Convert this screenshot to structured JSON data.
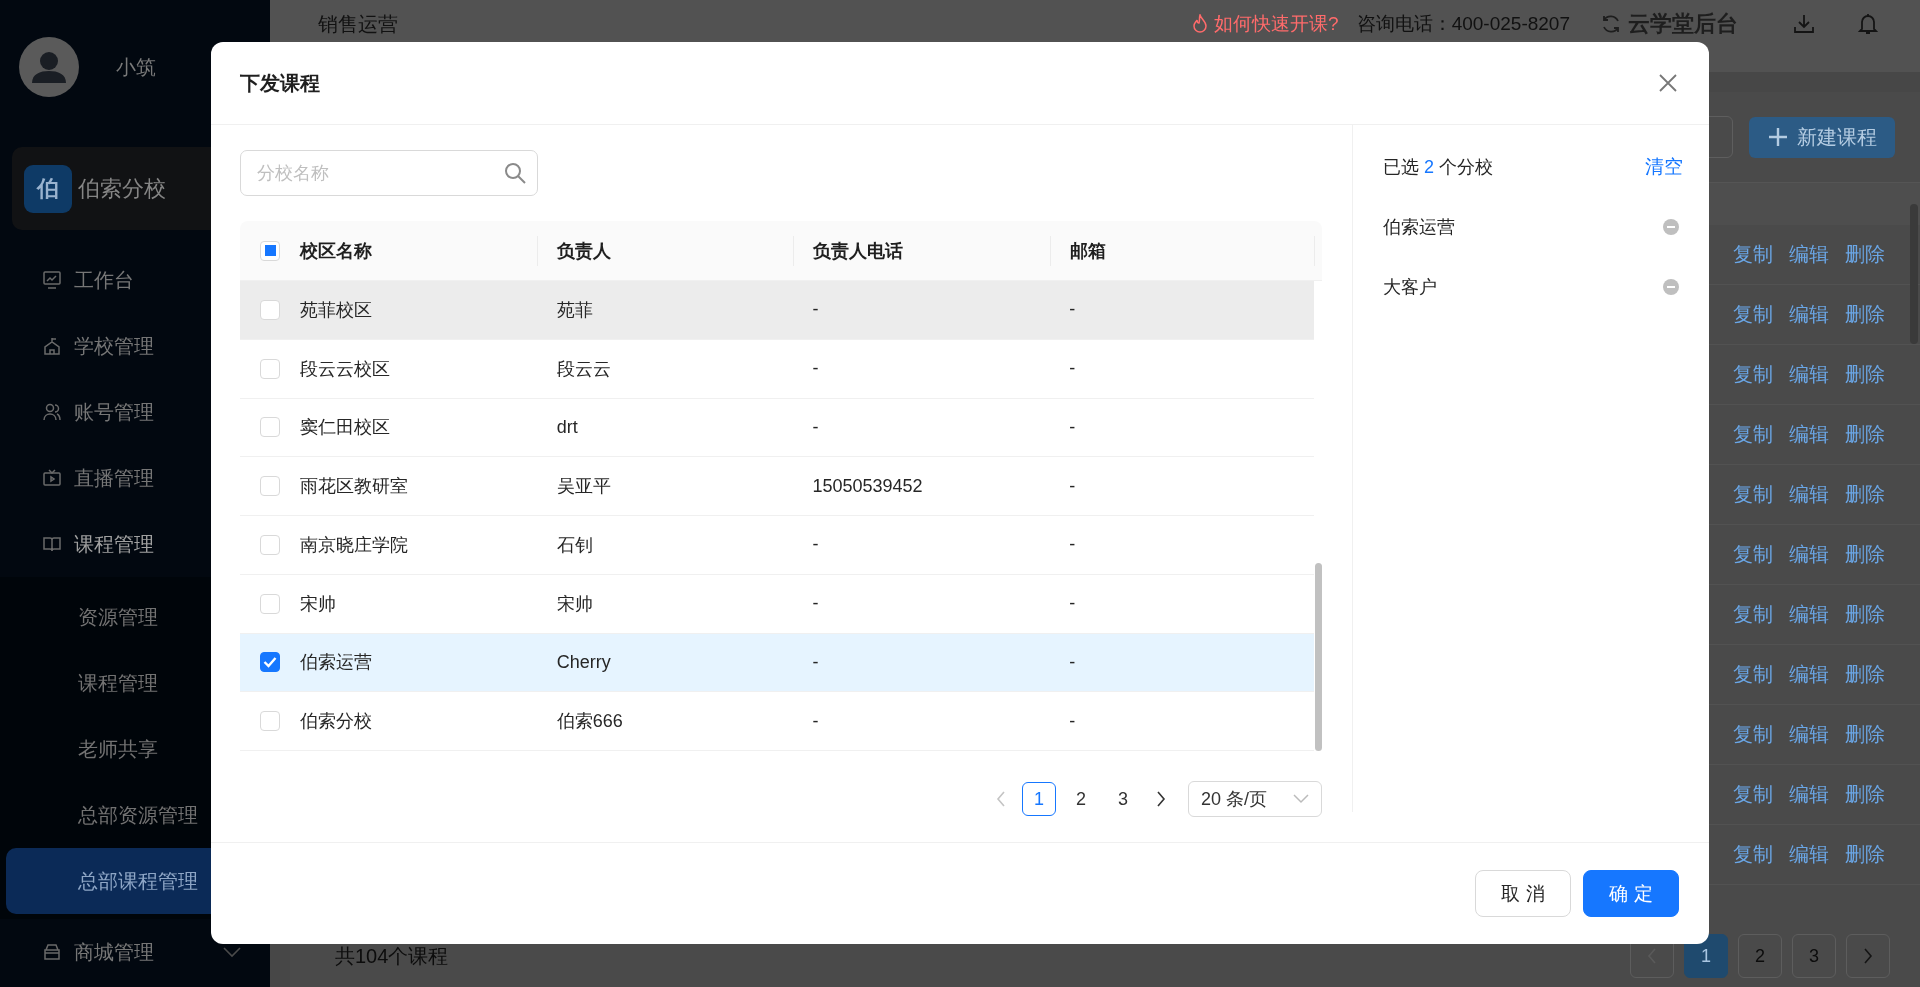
{
  "sidebar": {
    "user": {
      "name": "小筑"
    },
    "school": {
      "badge": "伯",
      "name": "伯索分校"
    },
    "menu": [
      {
        "label": "工作台"
      },
      {
        "label": "学校管理"
      },
      {
        "label": "账号管理"
      },
      {
        "label": "直播管理"
      },
      {
        "label": "课程管理",
        "expanded": true,
        "children": [
          {
            "label": "资源管理",
            "selected": false
          },
          {
            "label": "课程管理",
            "selected": false
          },
          {
            "label": "老师共享",
            "selected": false
          },
          {
            "label": "总部资源管理",
            "selected": false
          },
          {
            "label": "总部课程管理",
            "selected": true
          }
        ]
      },
      {
        "label": "商城管理",
        "expanded": false
      }
    ]
  },
  "header": {
    "title": "销售运营",
    "help_link": "如何快速开课?",
    "hotline": "咨询电话：400-025-8207",
    "brand": "云学堂后台"
  },
  "toolbar": {
    "new_button": "新建课程"
  },
  "course_table": {
    "rows": [
      {
        "actions": [
          "复制",
          "编辑",
          "删除"
        ]
      },
      {
        "actions": [
          "复制",
          "编辑",
          "删除"
        ]
      },
      {
        "actions": [
          "复制",
          "编辑",
          "删除"
        ]
      },
      {
        "actions": [
          "复制",
          "编辑",
          "删除"
        ]
      },
      {
        "actions": [
          "复制",
          "编辑",
          "删除"
        ]
      },
      {
        "actions": [
          "复制",
          "编辑",
          "删除"
        ]
      },
      {
        "actions": [
          "复制",
          "编辑",
          "删除"
        ]
      },
      {
        "actions": [
          "复制",
          "编辑",
          "删除"
        ]
      },
      {
        "actions": [
          "复制",
          "编辑",
          "删除"
        ]
      },
      {
        "actions": [
          "复制",
          "编辑",
          "删除"
        ]
      },
      {
        "actions": [
          "复制",
          "编辑",
          "删除"
        ]
      }
    ],
    "total": "共104个课程",
    "pages": [
      {
        "label": "1",
        "selected": true
      },
      {
        "label": "2",
        "selected": false
      },
      {
        "label": "3",
        "selected": false
      }
    ]
  },
  "dialog": {
    "title": "下发课程",
    "search": {
      "placeholder": "分校名称"
    },
    "table": {
      "select_all_partial": true,
      "columns": [
        "校区名称",
        "负责人",
        "负责人电话",
        "邮箱"
      ],
      "rows": [
        {
          "name": "苑菲校区",
          "owner": "苑菲",
          "phone": "-",
          "email": "-",
          "checked": false,
          "hovered": true
        },
        {
          "name": "段云云校区",
          "owner": "段云云",
          "phone": "-",
          "email": "-",
          "checked": false,
          "hovered": false
        },
        {
          "name": "窦仁田校区",
          "owner": "drt",
          "phone": "-",
          "email": "-",
          "checked": false,
          "hovered": false
        },
        {
          "name": "雨花区教研室",
          "owner": "吴亚平",
          "phone": "15050539452",
          "email": "-",
          "checked": false,
          "hovered": false
        },
        {
          "name": "南京晓庄学院",
          "owner": "石钊",
          "phone": "-",
          "email": "-",
          "checked": false,
          "hovered": false
        },
        {
          "name": "宋帅",
          "owner": "宋帅",
          "phone": "-",
          "email": "-",
          "checked": false,
          "hovered": false
        },
        {
          "name": "伯索运营",
          "owner": "Cherry",
          "phone": "-",
          "email": "-",
          "checked": true,
          "hovered": false
        },
        {
          "name": "伯索分校",
          "owner": "伯索666",
          "phone": "-",
          "email": "-",
          "checked": false,
          "hovered": false
        }
      ]
    },
    "pagination": {
      "pages": [
        {
          "label": "1",
          "selected": true
        },
        {
          "label": "2",
          "selected": false
        },
        {
          "label": "3",
          "selected": false
        }
      ],
      "page_size": "20 条/页"
    },
    "selection": {
      "prefix": "已选",
      "count": "2",
      "suffix": "个分校",
      "clear": "清空",
      "items": [
        "伯索运营",
        "大客户"
      ]
    },
    "buttons": [
      {
        "label": "取 消",
        "kind": "default"
      },
      {
        "label": "确 定",
        "kind": "primary"
      }
    ]
  }
}
